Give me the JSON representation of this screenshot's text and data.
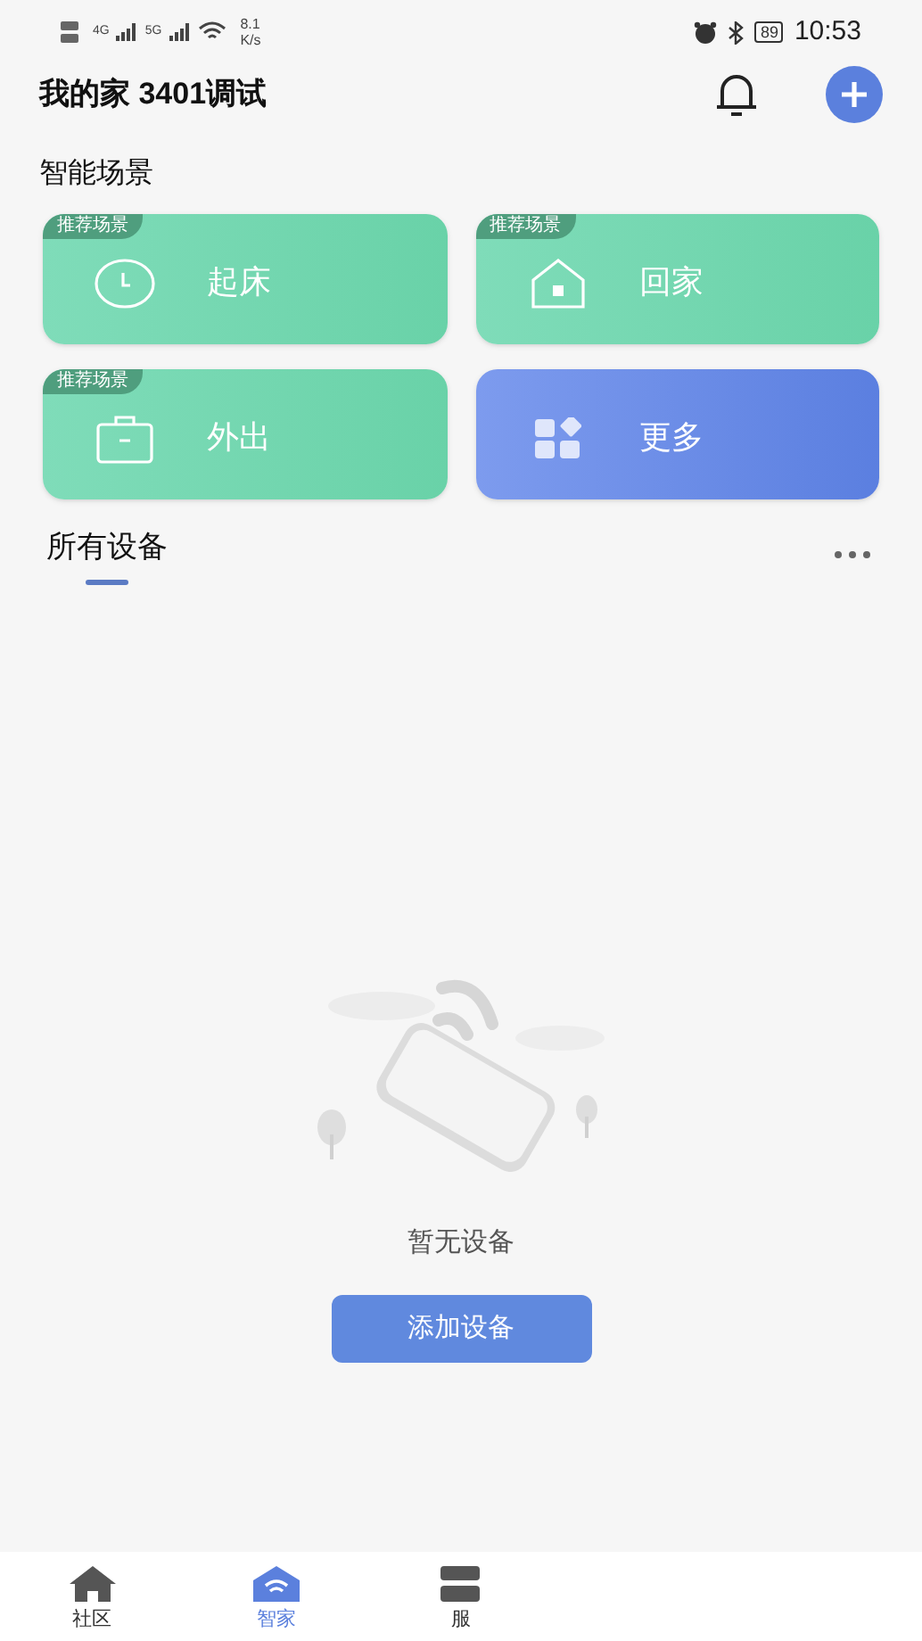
{
  "status_bar": {
    "network_1": "4G",
    "network_2": "5G",
    "speed": "8.1",
    "speed_unit": "K/s",
    "battery": "89",
    "time": "10:53"
  },
  "header": {
    "title": "我的家 3401调试"
  },
  "scenes": {
    "title": "智能场景",
    "items": [
      {
        "kind": "recommend",
        "badge": "推荐场景",
        "label": "起床"
      },
      {
        "kind": "recommend",
        "badge": "推荐场景",
        "label": "回家"
      },
      {
        "kind": "recommend",
        "badge": "推荐场景",
        "label": "外出"
      },
      {
        "kind": "more",
        "label": "更多"
      }
    ]
  },
  "devices": {
    "title": "所有设备",
    "empty_text": "暂无设备",
    "add_button": "添加设备"
  },
  "bottom_nav": [
    {
      "label": "社区",
      "selected": false
    },
    {
      "label": "智家",
      "selected": true
    },
    {
      "label": "服",
      "selected": false
    }
  ]
}
